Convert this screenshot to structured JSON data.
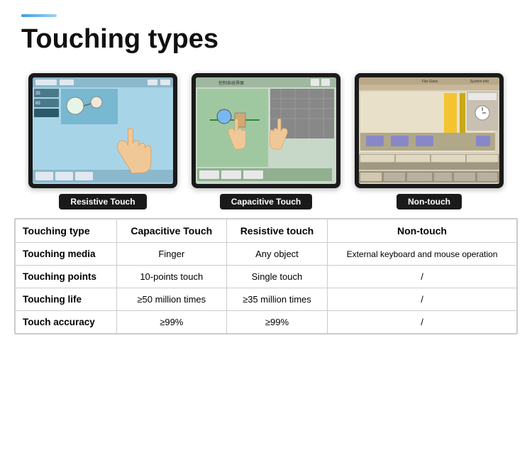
{
  "header": {
    "title": "Touching types",
    "accent_color": "#3b9fe8"
  },
  "monitors": [
    {
      "label": "Resistive Touch",
      "type": "resistive",
      "has_hand": true
    },
    {
      "label": "Capacitive Touch",
      "type": "capacitive",
      "has_hand": true
    },
    {
      "label": "Non-touch",
      "type": "nontouch",
      "has_hand": false
    }
  ],
  "table": {
    "headers": [
      "",
      "Capacitive Touch",
      "Resistive touch",
      "Non-touch"
    ],
    "rows": [
      {
        "label": "Touching type",
        "cols": [
          "Capacitive Touch",
          "Resistive touch",
          "Non-touch"
        ]
      },
      {
        "label": "Touching media",
        "cols": [
          "Finger",
          "Any object",
          "External keyboard and mouse operation"
        ]
      },
      {
        "label": "Touching points",
        "cols": [
          "10-points touch",
          "Single touch",
          "/"
        ]
      },
      {
        "label": "Touching life",
        "cols": [
          "≥50 million times",
          "≥35 million times",
          "/"
        ]
      },
      {
        "label": "Touch accuracy",
        "cols": [
          "≥99%",
          "≥99%",
          "/"
        ]
      }
    ]
  }
}
